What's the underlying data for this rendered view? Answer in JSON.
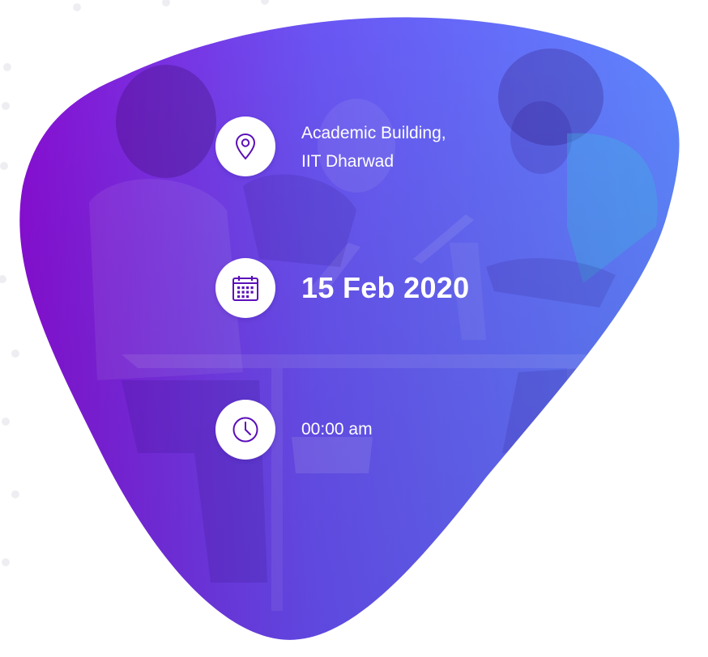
{
  "event": {
    "location_line1": "Academic Building,",
    "location_line2": "IIT Dharwad",
    "date": "15 Feb 2020",
    "time": "00:00 am"
  },
  "icons": {
    "location": "map-pin-icon",
    "date": "calendar-icon",
    "time": "clock-icon"
  },
  "colors": {
    "gradient_left": "#8a0fd6",
    "gradient_mid": "#6a55f3",
    "gradient_right": "#5f86ff",
    "icon_accent": "#5b0fb8",
    "text": "#ffffff"
  }
}
